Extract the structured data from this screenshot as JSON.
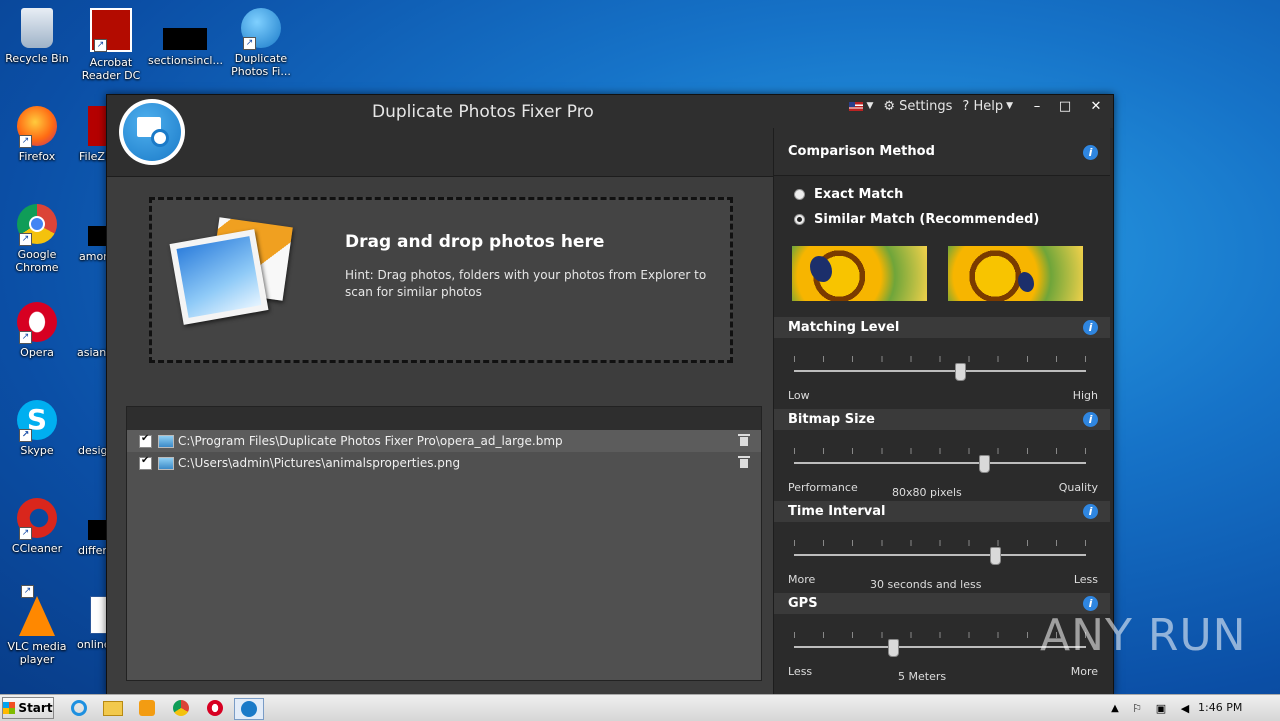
{
  "desktop": {
    "icons": [
      {
        "label": "Recycle Bin"
      },
      {
        "label": "Acrobat Reader DC"
      },
      {
        "label": "sectionsincl..."
      },
      {
        "label": "Duplicate Photos Fi..."
      },
      {
        "label": "Firefox"
      },
      {
        "label": "FileZi"
      },
      {
        "label": "Google Chrome"
      },
      {
        "label": "amon"
      },
      {
        "label": "Opera"
      },
      {
        "label": "asianb"
      },
      {
        "label": "Skype"
      },
      {
        "label": "desig"
      },
      {
        "label": "CCleaner"
      },
      {
        "label": "differ"
      },
      {
        "label": "VLC media player"
      },
      {
        "label": "online"
      }
    ]
  },
  "window": {
    "title": "Duplicate Photos Fixer Pro",
    "settings_label": "Settings",
    "help_label": "? Help",
    "minimize": "–",
    "maximize": "□",
    "close": "✕"
  },
  "dropzone": {
    "title": "Drag and drop photos here",
    "hint": "Hint: Drag photos, folders with your photos from Explorer to scan for similar photos"
  },
  "files": [
    {
      "path": "C:\\Program Files\\Duplicate Photos Fixer Pro\\opera_ad_large.bmp",
      "checked": true
    },
    {
      "path": "C:\\Users\\admin\\Pictures\\animalsproperties.png",
      "checked": true
    }
  ],
  "panel": {
    "comparison": {
      "title": "Comparison Method",
      "option_exact": "Exact Match",
      "option_similar": "Similar Match (Recommended)",
      "selected": "similar"
    },
    "matching": {
      "title": "Matching Level",
      "min": "Low",
      "max": "High",
      "level": 0.57
    },
    "bitmap": {
      "title": "Bitmap Size",
      "min": "Performance",
      "max": "Quality",
      "value_text": "80x80 pixels",
      "level": 0.65
    },
    "time": {
      "title": "Time Interval",
      "min": "More",
      "max": "Less",
      "value_text": "30 seconds and less",
      "level": 0.69
    },
    "gps": {
      "title": "GPS",
      "min": "Less",
      "max": "More",
      "value_text": "5 Meters",
      "level": 0.34
    }
  },
  "taskbar": {
    "start": "Start",
    "clock": "1:46 PM"
  },
  "watermark": "ANY RUN"
}
